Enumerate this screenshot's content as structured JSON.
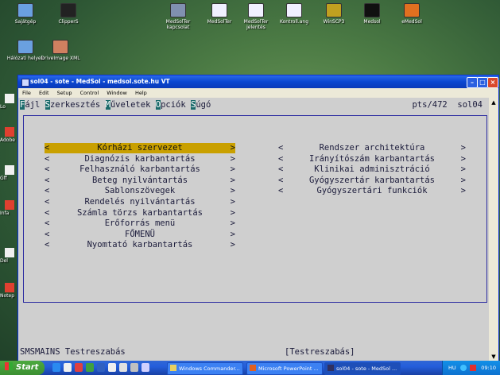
{
  "desktop": {
    "icons_top": [
      {
        "label": "Sajátgép",
        "color": "#6aa0e0"
      },
      {
        "label": "ClipperS",
        "color": "#222222"
      },
      {
        "label": "MedSolTer kapcsolat",
        "color": "#8090b0"
      },
      {
        "label": "MedSolTer",
        "color": "#f0f0ff"
      },
      {
        "label": "MedSolTer jelentés",
        "color": "#f0f0ff"
      },
      {
        "label": "Kontroll.ang",
        "color": "#f0f0ff"
      },
      {
        "label": "WinSCP3",
        "color": "#c0a020"
      },
      {
        "label": "Medsol",
        "color": "#101010"
      },
      {
        "label": "eMedSol",
        "color": "#e07020"
      }
    ],
    "icons_second": [
      {
        "label": "Hálózati helyek",
        "color": "#6aa0e0"
      },
      {
        "label": "DriveImage XML",
        "color": "#d08060"
      }
    ],
    "edge_labels": [
      "Lo",
      "Adobe",
      "Gff",
      "Infa",
      "Del",
      "Notep"
    ]
  },
  "window": {
    "title": "sol04 - sote - MedSol - medsol.sote.hu VT",
    "menubar": [
      "File",
      "Edit",
      "Setup",
      "Control",
      "Window",
      "Help"
    ]
  },
  "terminal": {
    "menu": [
      {
        "hotkey": "F",
        "rest": "ájl"
      },
      {
        "hotkey": "S",
        "rest": "zerkesztés"
      },
      {
        "hotkey": "M",
        "rest": "űveletek"
      },
      {
        "hotkey": "O",
        "rest": "pciók"
      },
      {
        "hotkey": "S",
        "rest": "úgó"
      }
    ],
    "right_info": "pts/472  sol04",
    "left_menu": [
      {
        "label": "Kórházi szervezet",
        "selected": true
      },
      {
        "label": "Diagnózis karbantartás",
        "selected": false
      },
      {
        "label": "Felhasználó karbantartás",
        "selected": false
      },
      {
        "label": "Beteg nyilvántartás",
        "selected": false
      },
      {
        "label": "Sablonszövegek",
        "selected": false
      },
      {
        "label": "Rendelés nyilvántartás",
        "selected": false
      },
      {
        "label": "Számla törzs karbantartás",
        "selected": false
      },
      {
        "label": "Erőforrás menü",
        "selected": false
      },
      {
        "label": "FŐMENÜ",
        "selected": false
      },
      {
        "label": "Nyomtató karbantartás",
        "selected": false
      }
    ],
    "right_menu": [
      {
        "label": "Rendszer architektúra"
      },
      {
        "label": "Irányítószám karbantartás"
      },
      {
        "label": "Klinikai adminisztráció"
      },
      {
        "label": "Gyógyszertár karbantartás"
      },
      {
        "label": "Gyógyszertári funkciók"
      }
    ],
    "bracket_left": "<",
    "bracket_right": ">",
    "status_left": "SMSMAINS Testreszabás",
    "status_right": "[Testreszabás]"
  },
  "taskbar": {
    "start_label": "Start",
    "buttons": [
      {
        "label": "Windows Commander...",
        "color": "#e8d060"
      },
      {
        "label": "Microsoft PowerPoint ...",
        "color": "#e06020"
      },
      {
        "label": "sol04 - sote - MedSol ...",
        "color": "#303060"
      }
    ],
    "tray_lang": "HU",
    "clock": "09:10"
  }
}
